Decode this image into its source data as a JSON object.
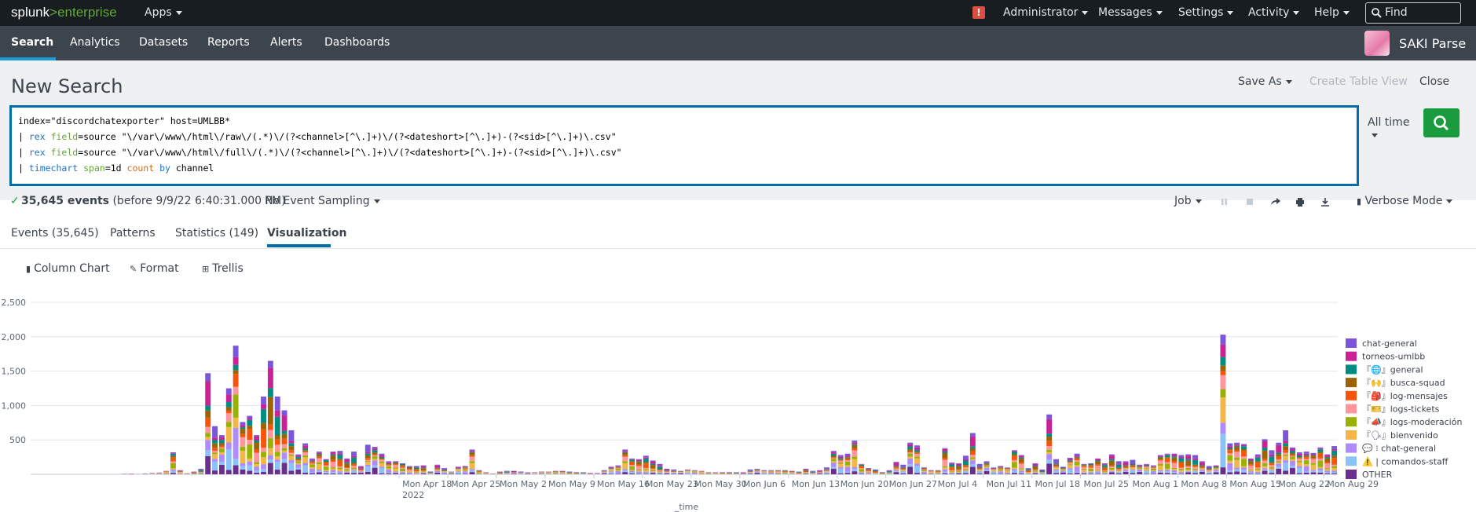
{
  "topbar": {
    "logo_a": "splunk",
    "logo_b": ">enterprise",
    "apps": "Apps",
    "alert_mark": "!",
    "administrator": "Administrator",
    "messages": "Messages",
    "settings": "Settings",
    "activity": "Activity",
    "help": "Help",
    "find_placeholder": "Find"
  },
  "appbar": {
    "items": [
      "Search",
      "Analytics",
      "Datasets",
      "Reports",
      "Alerts",
      "Dashboards"
    ],
    "app_name": "SAKI Parse"
  },
  "header": {
    "title": "New Search",
    "save_as": "Save As",
    "create_table_view": "Create Table View",
    "close": "Close"
  },
  "search": {
    "line1": "index=\"discordchatexporter\" host=UMLBB*",
    "line2_pre": "| ",
    "line2_kw": "rex",
    "line2_arg": "field",
    "line2_rest": "=source \"\\/var\\/www\\/html\\/raw\\/(.*)\\/(?<channel>[^\\.]+)\\/(?<dateshort>[^\\.]+)-(?<sid>[^\\.]+)\\.csv\"",
    "line3_rest": "=source \"\\/var\\/www\\/html\\/full\\/(.*)\\/(?<channel>[^\\.]+)\\/(?<dateshort>[^\\.]+)-(?<sid>[^\\.]+)\\.csv\"",
    "line4_kw": "timechart",
    "line4_arg": "span",
    "line4_mid": "=1d ",
    "line4_fn": "count",
    "line4_by": "by",
    "line4_end": " channel",
    "time_range": "All time"
  },
  "status": {
    "events_count": "35,645 events",
    "events_note": "(before 9/9/22 6:40:31.000 PM)",
    "sampling": "No Event Sampling",
    "job": "Job",
    "mode": "Verbose Mode"
  },
  "tabs": [
    "Events (35,645)",
    "Patterns",
    "Statistics (149)",
    "Visualization"
  ],
  "viz_toolbar": {
    "chart_type": "Column Chart",
    "format": "Format",
    "trellis": "Trellis"
  },
  "chart_data": {
    "type": "bar",
    "stacked": true,
    "xlabel": "_time",
    "ylabel": "",
    "ylim": [
      0,
      2500
    ],
    "yticks": [
      500,
      1000,
      1500,
      2000,
      2500
    ],
    "ytick_labels": [
      "500",
      "1,000",
      "1,500",
      "2,000",
      "2,500"
    ],
    "xtick_labels": [
      "Mon Apr 18",
      "Mon Apr 25",
      "Mon May 2",
      "Mon May 9",
      "Mon May 16",
      "Mon May 23",
      "Mon May 30",
      "Mon Jun 6",
      "Mon Jun 13",
      "Mon Jun 20",
      "Mon Jun 27",
      "Mon Jul 4",
      "Mon Jul 11",
      "Mon Jul 18",
      "Mon Jul 25",
      "Mon Aug 1",
      "Mon Aug 8",
      "Mon Aug 15",
      "Mon Aug 22",
      "Mon Aug 29"
    ],
    "xtick_year": "2022",
    "legend_position": "right",
    "series": [
      {
        "name": "chat-general",
        "color": "#7b56db"
      },
      {
        "name": "torneos-umlbb",
        "color": "#cb2196"
      },
      {
        "name": "『🌐』general",
        "color": "#008c80"
      },
      {
        "name": "『🙌』busca-squad",
        "color": "#9d6300"
      },
      {
        "name": "『🎒』log-mensajes",
        "color": "#f6540b"
      },
      {
        "name": "『🎫』logs-tickets",
        "color": "#ff969e"
      },
      {
        "name": "『📣』logs-moderación",
        "color": "#99b100"
      },
      {
        "name": "『🗣』bienvenido",
        "color": "#f4b649"
      },
      {
        "name": "💬 ⁝ chat-general",
        "color": "#ae8cff"
      },
      {
        "name": "⚠️ | comandos-staff",
        "color": "#8ac3f7"
      },
      {
        "name": "OTHER",
        "color": "#6a2e8e"
      }
    ],
    "daily_totals": [
      0,
      0,
      0,
      0,
      0,
      0,
      0,
      0,
      0,
      0,
      0,
      0,
      0,
      8,
      10,
      3,
      12,
      22,
      25,
      50,
      320,
      60,
      15,
      40,
      80,
      1470,
      700,
      570,
      1250,
      1870,
      760,
      850,
      570,
      1130,
      1650,
      1130,
      930,
      640,
      290,
      450,
      230,
      330,
      220,
      330,
      340,
      230,
      330,
      120,
      430,
      400,
      300,
      190,
      190,
      160,
      120,
      120,
      130,
      40,
      140,
      90,
      40,
      110,
      120,
      360,
      60,
      30,
      10,
      40,
      50,
      50,
      40,
      30,
      30,
      40,
      40,
      50,
      50,
      40,
      30,
      30,
      20,
      20,
      60,
      110,
      130,
      360,
      230,
      220,
      270,
      200,
      150,
      80,
      70,
      50,
      70,
      60,
      50,
      30,
      30,
      30,
      30,
      30,
      30,
      70,
      80,
      60,
      60,
      60,
      60,
      50,
      40,
      80,
      50,
      60,
      100,
      340,
      280,
      300,
      490,
      150,
      90,
      70,
      30,
      60,
      180,
      140,
      460,
      420,
      100,
      60,
      60,
      380,
      170,
      160,
      270,
      600,
      150,
      190,
      100,
      120,
      100,
      350,
      280,
      90,
      160,
      70,
      870,
      220,
      110,
      240,
      300,
      150,
      160,
      230,
      160,
      290,
      190,
      190,
      210,
      140,
      150,
      130,
      280,
      300,
      300,
      280,
      290,
      280,
      190,
      120,
      130,
      2030,
      450,
      460,
      440,
      230,
      290,
      510,
      350,
      460,
      640,
      390,
      320,
      330,
      310,
      390,
      290,
      410
    ]
  }
}
